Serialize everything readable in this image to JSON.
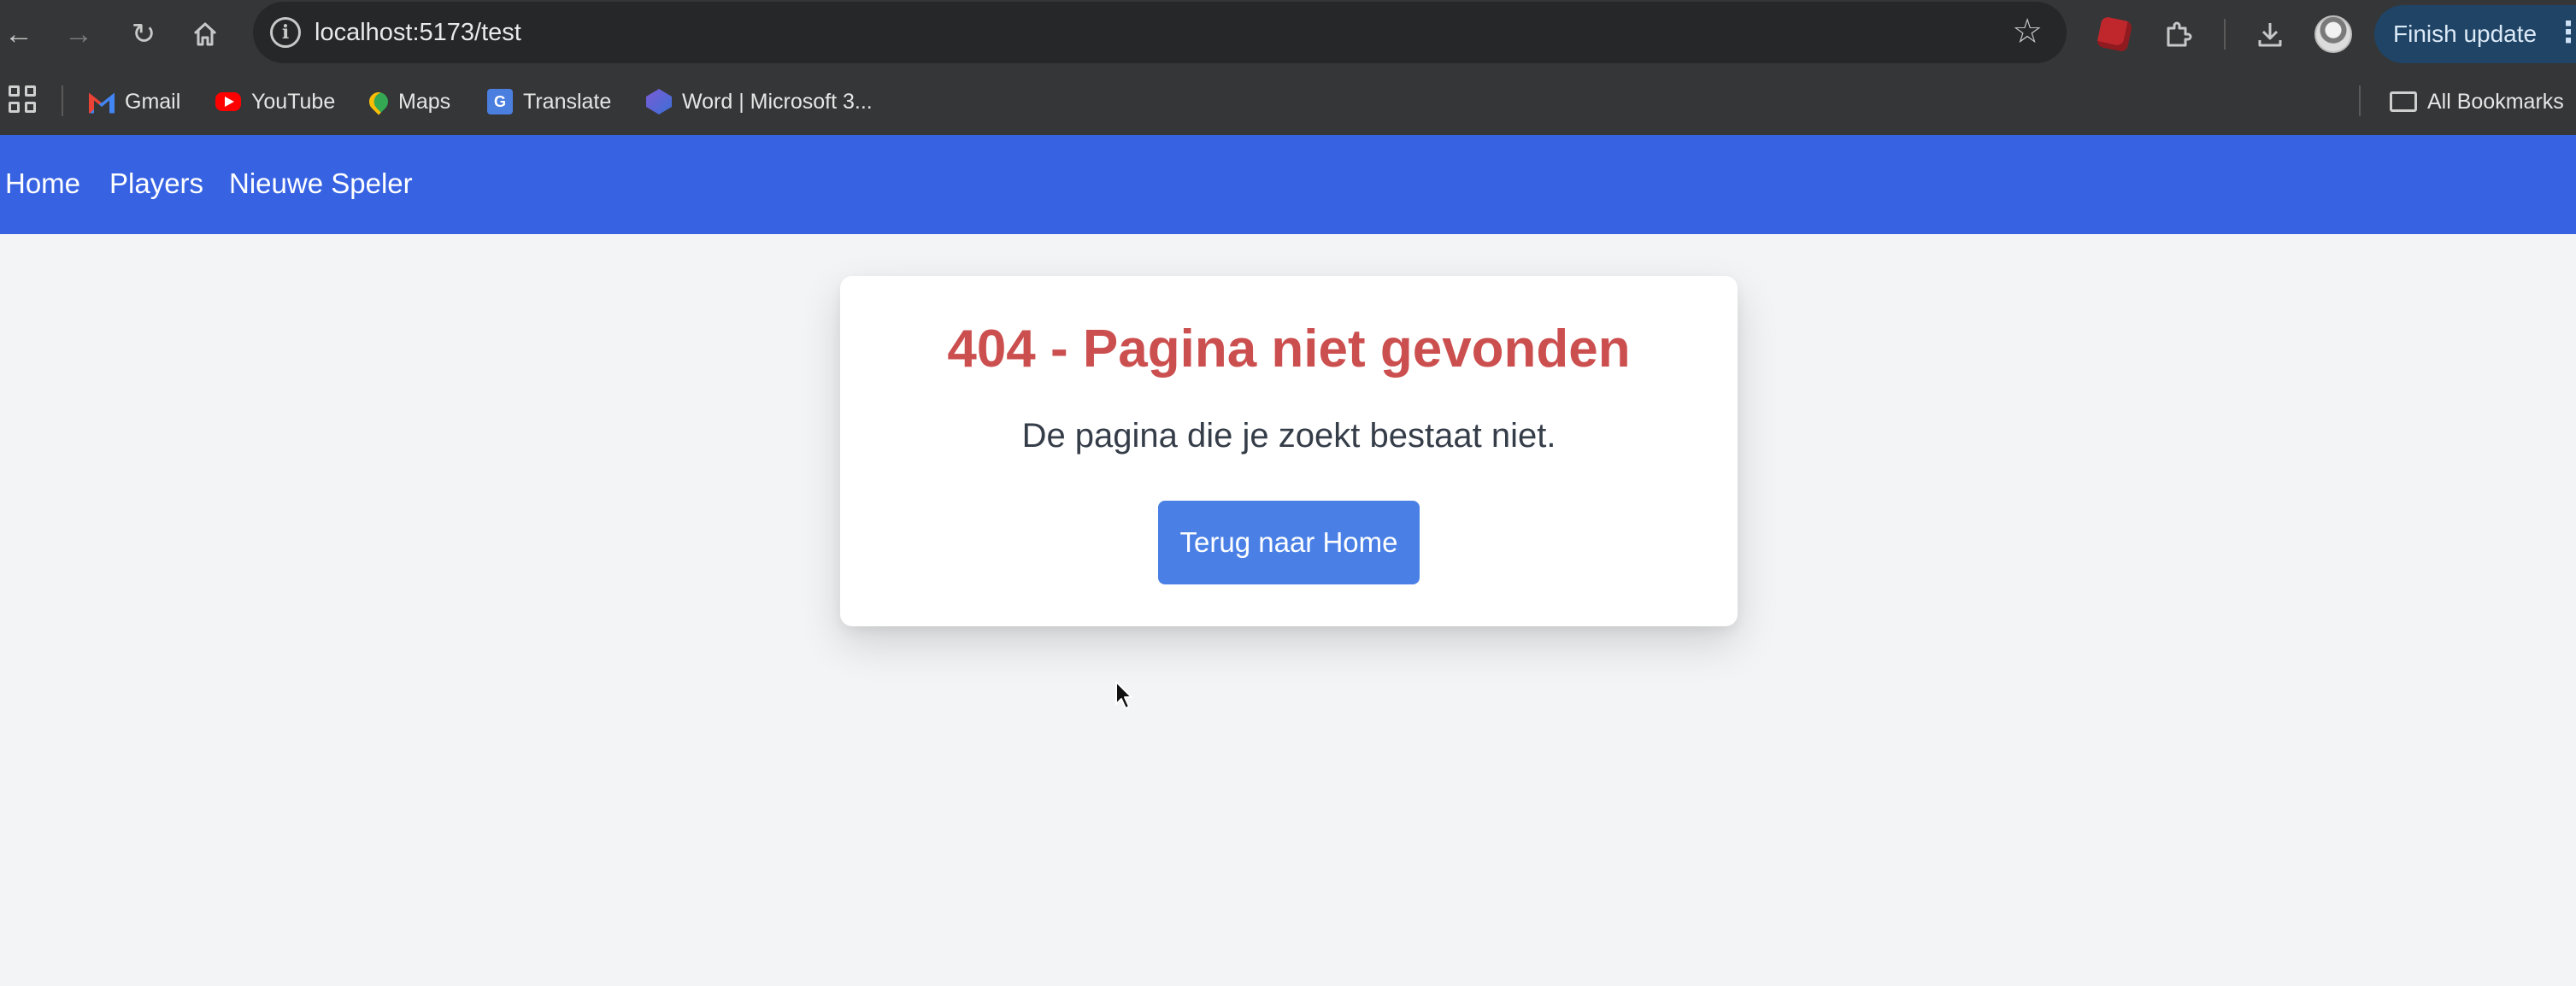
{
  "browser": {
    "url": "localhost:5173/test",
    "update_button_label": "Finish update",
    "bookmarks": [
      {
        "label": "Gmail",
        "icon": "gmail-icon"
      },
      {
        "label": "YouTube",
        "icon": "youtube-icon"
      },
      {
        "label": "Maps",
        "icon": "maps-icon"
      },
      {
        "label": "Translate",
        "icon": "translate-icon"
      },
      {
        "label": "Word | Microsoft 3...",
        "icon": "word-icon"
      }
    ],
    "all_bookmarks_label": "All Bookmarks"
  },
  "nav": {
    "items": [
      {
        "label": "Home"
      },
      {
        "label": "Players"
      },
      {
        "label": "Nieuwe Speler"
      }
    ],
    "color": "#3763e3"
  },
  "error_card": {
    "title": "404 - Pagina niet gevonden",
    "message": "De pagina die je zoekt bestaat niet.",
    "button_label": "Terug naar Home",
    "title_color": "#cc4f4f",
    "button_color": "#4a80e6"
  }
}
